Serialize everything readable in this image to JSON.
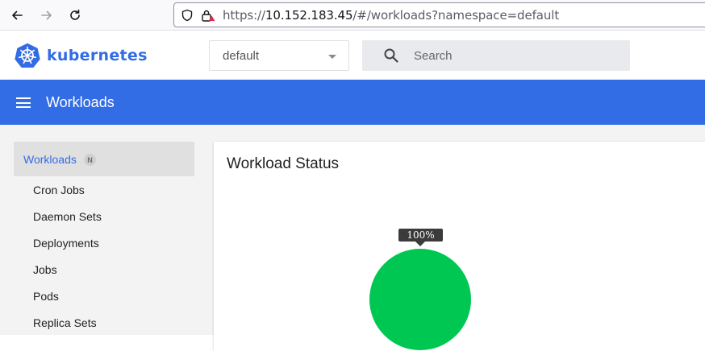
{
  "browser": {
    "url_prefix": "https://",
    "url_host": "10.152.183.45",
    "url_path": "/#/workloads?namespace=default"
  },
  "header": {
    "logo_text": "kubernetes",
    "namespace_value": "default",
    "search_placeholder": "Search"
  },
  "toolbar": {
    "title": "Workloads"
  },
  "sidebar": {
    "heading": "Workloads",
    "badge": "N",
    "items": [
      {
        "label": "Cron Jobs"
      },
      {
        "label": "Daemon Sets"
      },
      {
        "label": "Deployments"
      },
      {
        "label": "Jobs"
      },
      {
        "label": "Pods"
      },
      {
        "label": "Replica Sets"
      }
    ]
  },
  "card": {
    "title": "Workload Status"
  },
  "chart_data": {
    "type": "pie",
    "slices": [
      {
        "value": 100,
        "color": "#00c752"
      }
    ],
    "tooltip": "100%"
  },
  "colors": {
    "brand": "#326ce5",
    "toolbar": "#326de6",
    "success": "#00c752"
  }
}
